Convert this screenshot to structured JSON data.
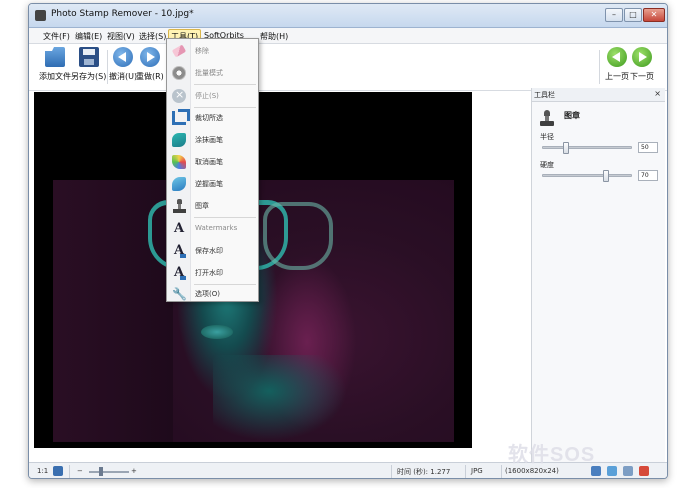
{
  "window": {
    "title": "Photo Stamp Remover - 10.jpg*",
    "min_glyph": "–",
    "max_glyph": "□",
    "close_glyph": "✕"
  },
  "menubar": {
    "items": [
      "文件(F)",
      "编辑(E)",
      "视图(V)",
      "选择(S)",
      "工具(T)",
      "SoftOrbits",
      "帮助(H)"
    ],
    "active": "工具(T)"
  },
  "toolbar": {
    "add_file": "添加文件",
    "save_as": "另存为(S)",
    "undo": "撤消(U)",
    "redo": "重做(R)",
    "partial": "恳",
    "prev_page": "上一页",
    "next_page": "下一页"
  },
  "tools_menu": {
    "items": [
      {
        "label": "移除",
        "icon": "eraser-icon",
        "disabled": true
      },
      {
        "label": "批量模式",
        "icon": "gear-icon",
        "disabled": true
      },
      {
        "label": "停止(S)",
        "icon": "stop-icon",
        "disabled": true
      },
      {
        "label": "裁切所选",
        "icon": "crop-icon",
        "disabled": false
      },
      {
        "label": "涂抹画笔",
        "icon": "brush-icon",
        "disabled": false
      },
      {
        "label": "取消画笔",
        "icon": "cancel-brush-icon",
        "disabled": false
      },
      {
        "label": "逆握画笔",
        "icon": "reverse-brush-icon",
        "disabled": false
      },
      {
        "label": "图章",
        "icon": "stamp-icon",
        "disabled": false
      },
      {
        "label": "Watermarks",
        "icon": "text-a-icon",
        "disabled": true
      },
      {
        "label": "保存水印",
        "icon": "save-watermark-icon",
        "disabled": false
      },
      {
        "label": "打开水印",
        "icon": "open-watermark-icon",
        "disabled": false
      },
      {
        "label": "选项(O)",
        "icon": "wrench-icon",
        "disabled": false
      }
    ]
  },
  "panel": {
    "title": "工具栏",
    "close": "×",
    "tool_name": "图章",
    "radius_label": "半径",
    "radius_value": "50",
    "hardness_label": "硬度",
    "hardness_value": "70"
  },
  "statusbar": {
    "zoom_ratio": "1:1",
    "time_label": "时间 (秒): 1.277",
    "format": "JPG",
    "dimensions": "(1600x820x24)"
  },
  "watermark_text": "软件SOS",
  "colors": {
    "accent": "#2f6fb8",
    "nav_green": "#3d9a1e",
    "menu_active": "#fff3b5"
  }
}
